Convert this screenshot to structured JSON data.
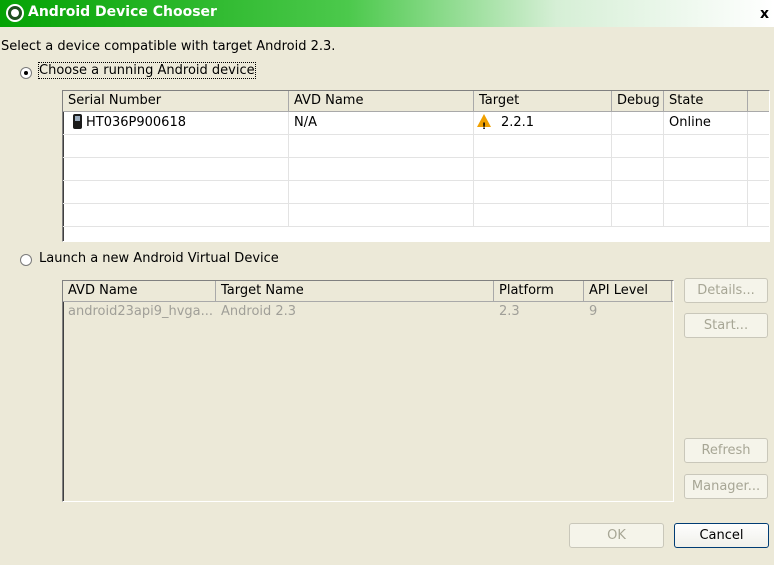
{
  "window": {
    "title": "Android Device Chooser",
    "close_glyph": "x"
  },
  "intro_text": "Select a device compatible with target Android 2.3.",
  "running": {
    "radio_label": "Choose a running Android device",
    "selected": true,
    "columns": [
      "Serial Number",
      "AVD Name",
      "Target",
      "Debug",
      "State"
    ],
    "rows": [
      {
        "serial": "HT036P900618",
        "avd": "N/A",
        "target": "2.2.1",
        "debug": "",
        "state": "Online",
        "target_icon": "warning-icon",
        "serial_icon": "phone-icon"
      }
    ]
  },
  "launch": {
    "radio_label": "Launch a new Android Virtual Device",
    "selected": false,
    "columns": [
      "AVD Name",
      "Target Name",
      "Platform",
      "API Level"
    ],
    "rows": [
      {
        "avd": "android23api9_hvga...",
        "target": "Android 2.3",
        "platform": "2.3",
        "api": "9"
      }
    ]
  },
  "side_buttons": {
    "details": "Details...",
    "start": "Start...",
    "refresh": "Refresh",
    "manager": "Manager..."
  },
  "footer": {
    "ok": "OK",
    "cancel": "Cancel"
  },
  "colors": {
    "title_bar": "#05a305",
    "dialog_bg": "#ece9d8",
    "disabled_text": "#a09f98"
  }
}
